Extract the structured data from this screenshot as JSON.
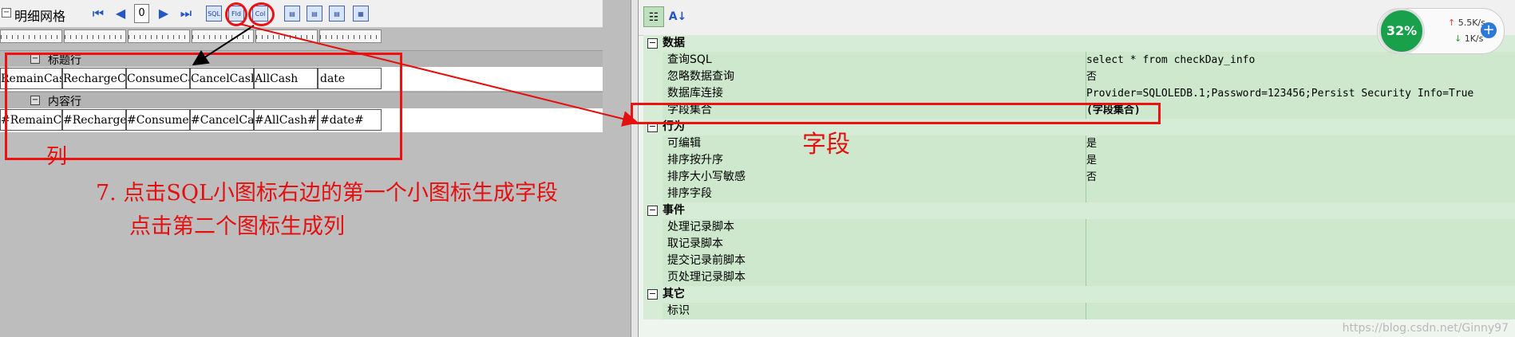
{
  "left": {
    "toolbar": {
      "title": "明细网格",
      "page_value": "0",
      "icons": [
        "SQL",
        "Fld",
        "Col"
      ]
    },
    "header_band": {
      "label": "标题行"
    },
    "header_cells": [
      "RemainCash",
      "RechargeCash",
      "ConsumeCash",
      "CancelCash",
      "AllCash",
      "date"
    ],
    "content_band": {
      "label": "内容行"
    },
    "content_cells": [
      "#RemainCash#",
      "#RechargeCash#",
      "#ConsumeCash#",
      "#CancelCash#",
      "#AllCash#",
      "#date#"
    ],
    "annotation_col": "列",
    "annotation_step": "7. 点击SQL小图标右边的第一个小图标生成字段",
    "annotation_step2": "点击第二个图标生成列"
  },
  "annotation_field": "字段",
  "property_grid": {
    "categories": [
      {
        "name": "数据",
        "props": [
          {
            "name": "查询SQL",
            "value": "select * from checkDay_info"
          },
          {
            "name": "忽略数据查询",
            "value": "否"
          },
          {
            "name": "数据库连接",
            "value": "Provider=SQLOLEDB.1;Password=123456;Persist Security Info=True"
          },
          {
            "name": "字段集合",
            "value": "(字段集合)"
          }
        ]
      },
      {
        "name": "行为",
        "props": [
          {
            "name": "可编辑",
            "value": "是"
          },
          {
            "name": "排序按升序",
            "value": "是"
          },
          {
            "name": "排序大小写敏感",
            "value": "否"
          },
          {
            "name": "排序字段",
            "value": ""
          }
        ]
      },
      {
        "name": "事件",
        "props": [
          {
            "name": "处理记录脚本",
            "value": ""
          },
          {
            "name": "取记录脚本",
            "value": ""
          },
          {
            "name": "提交记录前脚本",
            "value": ""
          },
          {
            "name": "页处理记录脚本",
            "value": ""
          }
        ]
      },
      {
        "name": "其它",
        "props": [
          {
            "name": "标识",
            "value": ""
          }
        ]
      }
    ]
  },
  "speed_widget": {
    "percent": "32%",
    "up": "5.5K/s",
    "down": "1K/s"
  },
  "watermark": "https://blog.csdn.net/Ginny97"
}
